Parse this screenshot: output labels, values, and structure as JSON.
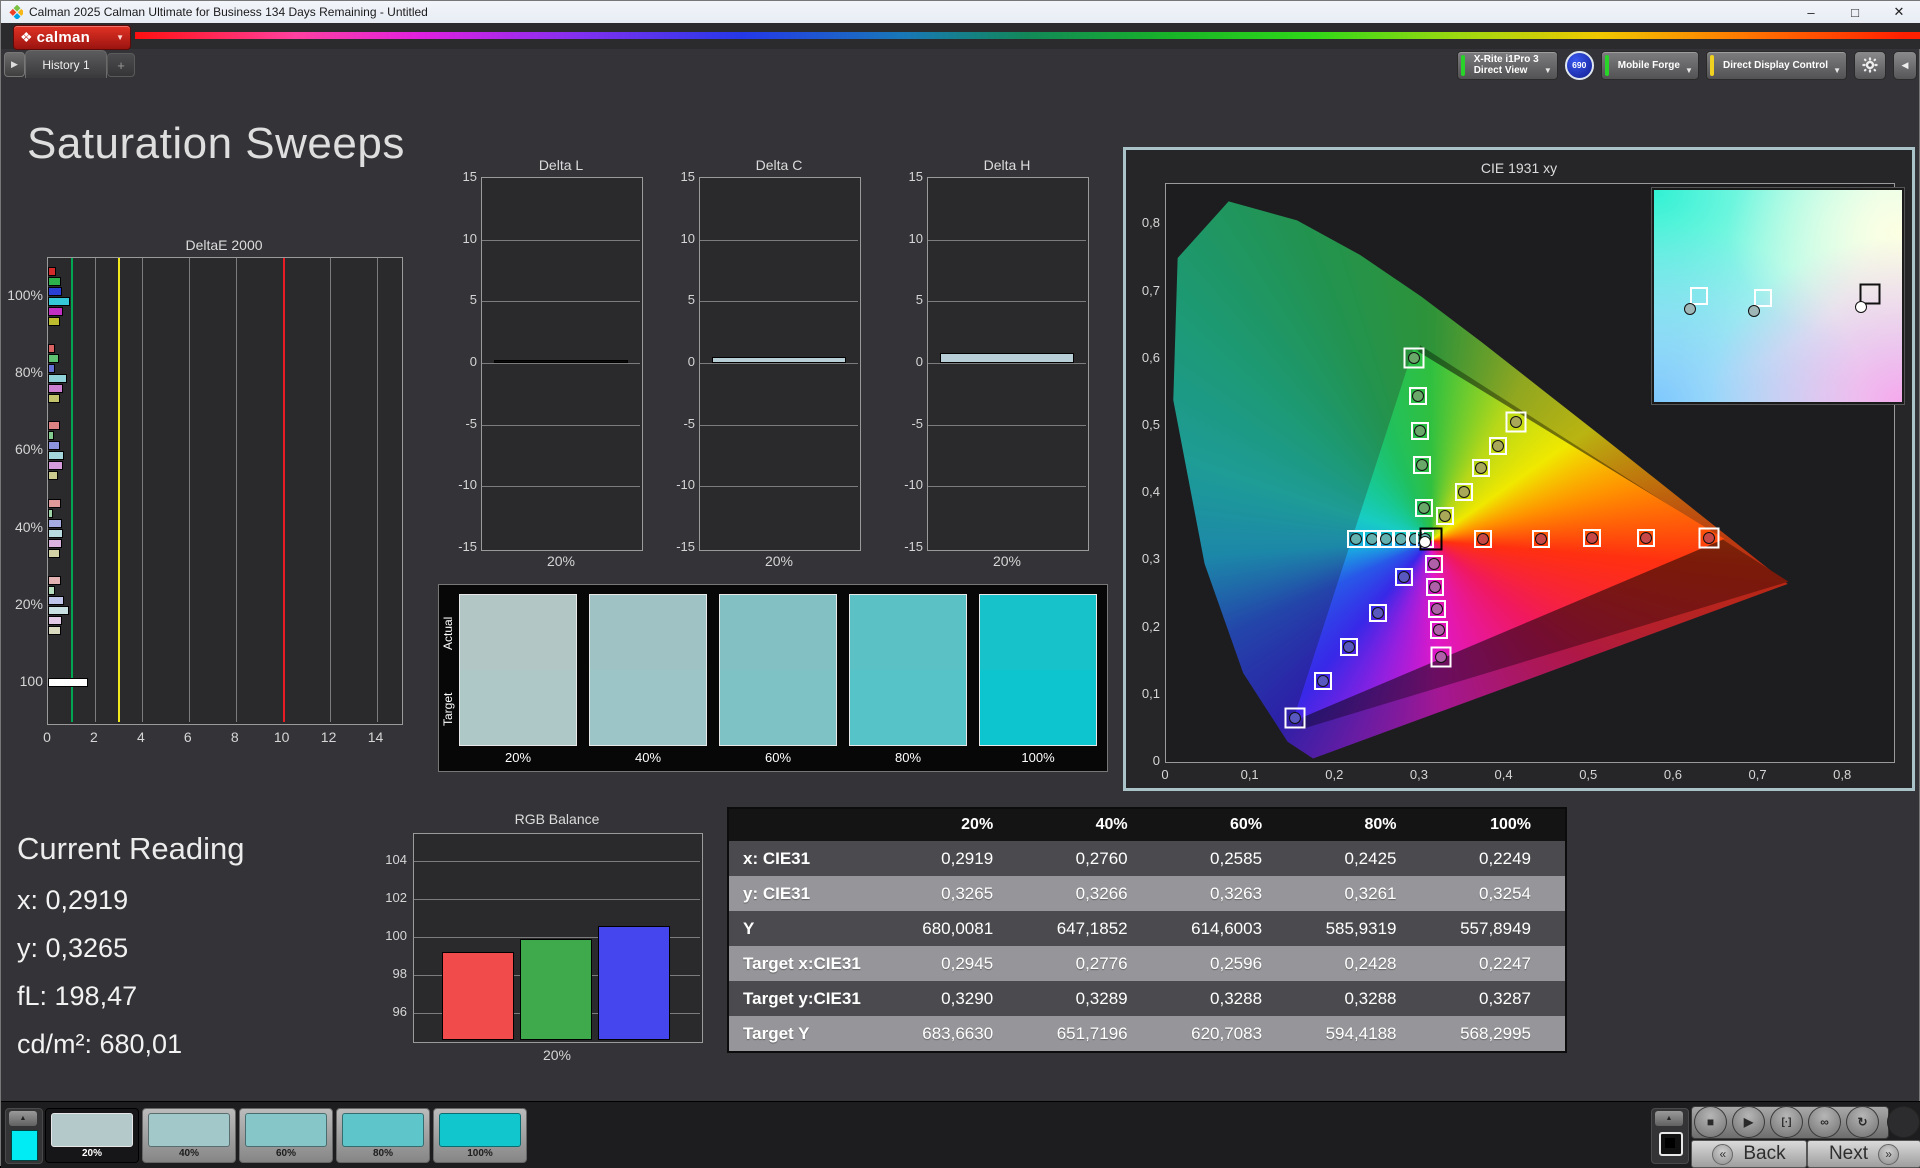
{
  "window": {
    "title": "Calman 2025 Calman Ultimate for Business 134 Days Remaining  - Untitled",
    "minimize": "–",
    "maximize": "□",
    "close": "✕"
  },
  "brand": {
    "logo_glyph": "❖",
    "logo_text": "calman",
    "dropdown": "▼"
  },
  "tabs": {
    "arrow": "▶",
    "history": "History 1",
    "add": "+"
  },
  "device_bar": {
    "buttons": [
      {
        "label": "X-Rite i1Pro 3\nDirect View",
        "accent": "#27d427",
        "chevron": "▼"
      },
      {
        "label": "Mobile Forge",
        "accent": "#27d427",
        "chevron": "▼"
      },
      {
        "label": "Direct Display Control",
        "accent": "#f0d020",
        "chevron": "▼"
      }
    ],
    "badge": "690",
    "collapse": "◀"
  },
  "page": {
    "title": "Saturation Sweeps"
  },
  "current_reading": {
    "title": "Current Reading",
    "lines": [
      "x: 0,2919",
      "y: 0,3265",
      "fL: 198,47",
      "cd/m²: 680,01"
    ]
  },
  "chart_data": [
    {
      "type": "bar",
      "title": "DeltaE 2000",
      "orientation": "horizontal",
      "x_ticks": [
        "0",
        "2",
        "4",
        "6",
        "8",
        "10",
        "12",
        "14"
      ],
      "x_max": 15,
      "ref_lines": [
        {
          "v": 1,
          "color": "#00a651"
        },
        {
          "v": 3,
          "color": "#f2e81e"
        },
        {
          "v": 10,
          "color": "#e81c24"
        }
      ],
      "groups": [
        {
          "label": "100%",
          "bars": [
            {
              "c": "#d42a2a",
              "v": 0.35
            },
            {
              "c": "#2db14c",
              "v": 0.55
            },
            {
              "c": "#2a3fd4",
              "v": 0.6
            },
            {
              "c": "#35c8d8",
              "v": 0.95
            },
            {
              "c": "#c32ec3",
              "v": 0.65
            },
            {
              "c": "#bcbc2e",
              "v": 0.5
            }
          ]
        },
        {
          "label": "80%",
          "bars": [
            {
              "c": "#d96262",
              "v": 0.3
            },
            {
              "c": "#5fc273",
              "v": 0.45
            },
            {
              "c": "#6470d6",
              "v": 0.28
            },
            {
              "c": "#8fd2da",
              "v": 0.8
            },
            {
              "c": "#cd7fd2",
              "v": 0.65
            },
            {
              "c": "#c3c36e",
              "v": 0.5
            }
          ]
        },
        {
          "label": "60%",
          "bars": [
            {
              "c": "#dd8282",
              "v": 0.5
            },
            {
              "c": "#84cb90",
              "v": 0.27
            },
            {
              "c": "#8b94dd",
              "v": 0.5
            },
            {
              "c": "#a5d6dc",
              "v": 0.7
            },
            {
              "c": "#d69bda",
              "v": 0.65
            },
            {
              "c": "#caca8e",
              "v": 0.42
            }
          ]
        },
        {
          "label": "40%",
          "bars": [
            {
              "c": "#e09a9a",
              "v": 0.55
            },
            {
              "c": "#9fd4a8",
              "v": 0.22
            },
            {
              "c": "#a6ace2",
              "v": 0.6
            },
            {
              "c": "#b7dbde",
              "v": 0.66
            },
            {
              "c": "#dcb3e0",
              "v": 0.6
            },
            {
              "c": "#d2d2a6",
              "v": 0.5
            }
          ]
        },
        {
          "label": "20%",
          "bars": [
            {
              "c": "#e3b2b2",
              "v": 0.55
            },
            {
              "c": "#b8dec0",
              "v": 0.3
            },
            {
              "c": "#bfc4ea",
              "v": 0.7
            },
            {
              "c": "#c8e0e2",
              "v": 0.9
            },
            {
              "c": "#e2c9e5",
              "v": 0.6
            },
            {
              "c": "#dadac0",
              "v": 0.55
            }
          ]
        },
        {
          "label": "100",
          "bars": [
            {
              "c": "#ffffff",
              "v": 1.7
            }
          ]
        }
      ]
    },
    {
      "type": "bar",
      "title": "Delta L",
      "x_label": "20%",
      "y_ticks": [
        "15",
        "10",
        "5",
        "0",
        "-5",
        "-10",
        "-15"
      ],
      "ylim": [
        -15,
        15
      ],
      "value": 0.12,
      "bar_color": "#0a0a0a"
    },
    {
      "type": "bar",
      "title": "Delta C",
      "x_label": "20%",
      "y_ticks": [
        "15",
        "10",
        "5",
        "0",
        "-5",
        "-10",
        "-15"
      ],
      "ylim": [
        -15,
        15
      ],
      "value": 0.5,
      "bar_color": "#b7ced6"
    },
    {
      "type": "bar",
      "title": "Delta H",
      "x_label": "20%",
      "y_ticks": [
        "15",
        "10",
        "5",
        "0",
        "-5",
        "-10",
        "-15"
      ],
      "ylim": [
        -15,
        15
      ],
      "value": 0.85,
      "bar_color": "#b7ced6"
    },
    {
      "type": "bar",
      "title": "RGB Balance",
      "x_label": "20%",
      "y_ticks": [
        "104",
        "102",
        "100",
        "98",
        "96"
      ],
      "ylim": [
        94.6,
        105.4
      ],
      "series": [
        {
          "name": "red",
          "value": 99.2,
          "color": "#f24b4b"
        },
        {
          "name": "green",
          "value": 99.9,
          "color": "#3faa4c"
        },
        {
          "name": "blue",
          "value": 100.6,
          "color": "#4646ee"
        }
      ]
    },
    {
      "type": "scatter",
      "title": "CIE 1931 xy",
      "x_ticks": [
        "0",
        "0,1",
        "0,2",
        "0,3",
        "0,4",
        "0,5",
        "0,6",
        "0,7",
        "0,8"
      ],
      "y_ticks": [
        "0",
        "0,1",
        "0,2",
        "0,3",
        "0,4",
        "0,5",
        "0,6",
        "0,7",
        "0,8"
      ],
      "axis_max": 0.86,
      "white_row": {
        "y": 0.332,
        "squares_x": [
          0.225,
          0.2428,
          0.2596,
          0.2776,
          0.2945,
          0.306
        ],
        "circle_color": "#63b2b0",
        "target_square": {
          "x": 0.3127,
          "y": 0.332
        },
        "white_circle": {
          "x": 0.3055,
          "y": 0.327
        }
      },
      "sweeps": [
        {
          "name": "red",
          "color": "#c84848",
          "points": [
            [
              0.375,
              0.332
            ],
            [
              0.443,
              0.332
            ],
            [
              0.503,
              0.333
            ],
            [
              0.567,
              0.333
            ]
          ],
          "end": [
            0.641,
            0.333
          ]
        },
        {
          "name": "green",
          "color": "#6aa86a",
          "points": [
            [
              0.305,
              0.378
            ],
            [
              0.302,
              0.442
            ],
            [
              0.3,
              0.492
            ],
            [
              0.298,
              0.545
            ]
          ],
          "end": [
            0.293,
            0.601
          ]
        },
        {
          "name": "yellow",
          "color": "#a8a858",
          "points": [
            [
              0.33,
              0.366
            ],
            [
              0.352,
              0.402
            ],
            [
              0.372,
              0.437
            ],
            [
              0.392,
              0.47
            ]
          ],
          "end": [
            0.413,
            0.506
          ]
        },
        {
          "name": "magenta",
          "color": "#b060a8",
          "points": [
            [
              0.317,
              0.295
            ],
            [
              0.318,
              0.261
            ],
            [
              0.32,
              0.228
            ],
            [
              0.322,
              0.196
            ]
          ],
          "end": [
            0.325,
            0.156
          ]
        },
        {
          "name": "blue",
          "color": "#5858c0",
          "points": [
            [
              0.281,
              0.276
            ],
            [
              0.251,
              0.221
            ],
            [
              0.216,
              0.171
            ],
            [
              0.186,
              0.121
            ]
          ],
          "end": [
            0.152,
            0.066
          ]
        }
      ],
      "inset_markers": [
        {
          "x": 18,
          "y": 50,
          "square": "#ffffff",
          "circle": "#9fb6b6"
        },
        {
          "x": 44,
          "y": 51,
          "square": "#ffffff",
          "circle": "#9fb6b6"
        },
        {
          "x": 87,
          "y": 49,
          "square": "#111111",
          "circle": "#ffffff"
        }
      ]
    }
  ],
  "swatch_strip": {
    "row_labels": [
      "Actual",
      "Target"
    ],
    "cells": [
      {
        "label": "20%",
        "actual": "#b2c6c6",
        "target": "#aec7c7"
      },
      {
        "label": "40%",
        "actual": "#9fc3c5",
        "target": "#9bc5c7"
      },
      {
        "label": "60%",
        "actual": "#82c0c3",
        "target": "#7ec2c5"
      },
      {
        "label": "80%",
        "actual": "#5cc1c5",
        "target": "#56c3c8"
      },
      {
        "label": "100%",
        "actual": "#17c2ca",
        "target": "#0cc5ce"
      }
    ]
  },
  "table": {
    "col_headers": [
      "",
      "20%",
      "40%",
      "60%",
      "80%",
      "100%"
    ],
    "rows": [
      {
        "label": "x: CIE31",
        "values": [
          "0,2919",
          "0,2760",
          "0,2585",
          "0,2425",
          "0,2249"
        ]
      },
      {
        "label": "y: CIE31",
        "values": [
          "0,3265",
          "0,3266",
          "0,3263",
          "0,3261",
          "0,3254"
        ]
      },
      {
        "label": "Y",
        "values": [
          "680,0081",
          "647,1852",
          "614,6003",
          "585,9319",
          "557,8949"
        ]
      },
      {
        "label": "Target x:CIE31",
        "values": [
          "0,2945",
          "0,2776",
          "0,2596",
          "0,2428",
          "0,2247"
        ]
      },
      {
        "label": "Target y:CIE31",
        "values": [
          "0,3290",
          "0,3289",
          "0,3288",
          "0,3288",
          "0,3287"
        ]
      },
      {
        "label": "Target Y",
        "values": [
          "683,6630",
          "651,7196",
          "620,7083",
          "594,4188",
          "568,2995"
        ]
      }
    ]
  },
  "bottom_bar": {
    "left_swatch_color": "#00ecf4",
    "arrow": "▲",
    "tiles": [
      {
        "label": "20%",
        "color": "#b4c9c9",
        "selected": true
      },
      {
        "label": "40%",
        "color": "#a3c8ca",
        "selected": false
      },
      {
        "label": "60%",
        "color": "#86c6c8",
        "selected": false
      },
      {
        "label": "80%",
        "color": "#5ec6ca",
        "selected": false
      },
      {
        "label": "100%",
        "color": "#12c6ce",
        "selected": false
      }
    ],
    "controls": [
      {
        "name": "stop",
        "glyph": "■"
      },
      {
        "name": "play",
        "glyph": "▶"
      },
      {
        "name": "frame",
        "glyph": "[·]"
      },
      {
        "name": "loop",
        "glyph": "∞"
      },
      {
        "name": "refresh",
        "glyph": "↻"
      }
    ],
    "back_label": "Back",
    "next_label": "Next",
    "back_chevron": "«",
    "next_chevron": "»"
  }
}
